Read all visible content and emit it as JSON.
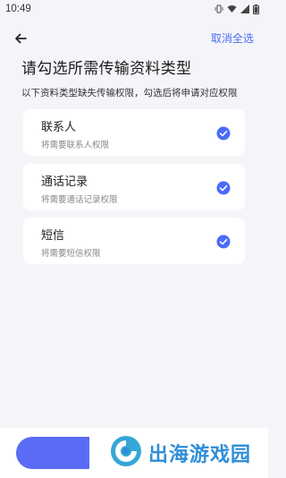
{
  "status_bar": {
    "time": "10:49",
    "icons": [
      "vibrate-icon",
      "wifi-icon",
      "signal-icon",
      "battery-icon"
    ]
  },
  "nav": {
    "back_icon": "arrow-left-icon",
    "cancel_all_label": "取消全选"
  },
  "header": {
    "title": "请勾选所需传输资料类型",
    "description": "以下资料类型缺失传输权限，勾选后将申请对应权限"
  },
  "items": [
    {
      "title": "联系人",
      "subtitle": "将需要联系人权限",
      "checked": true
    },
    {
      "title": "通话记录",
      "subtitle": "将需要通话记录权限",
      "checked": true
    },
    {
      "title": "短信",
      "subtitle": "将需要短信权限",
      "checked": true
    }
  ],
  "bottom": {
    "watermark_text": "出海游戏园"
  },
  "colors": {
    "accent": "#4a6cf7",
    "background": "#f4f5f9",
    "card": "#ffffff",
    "button": "#5a6cf5",
    "watermark": "#2f8ed8"
  }
}
